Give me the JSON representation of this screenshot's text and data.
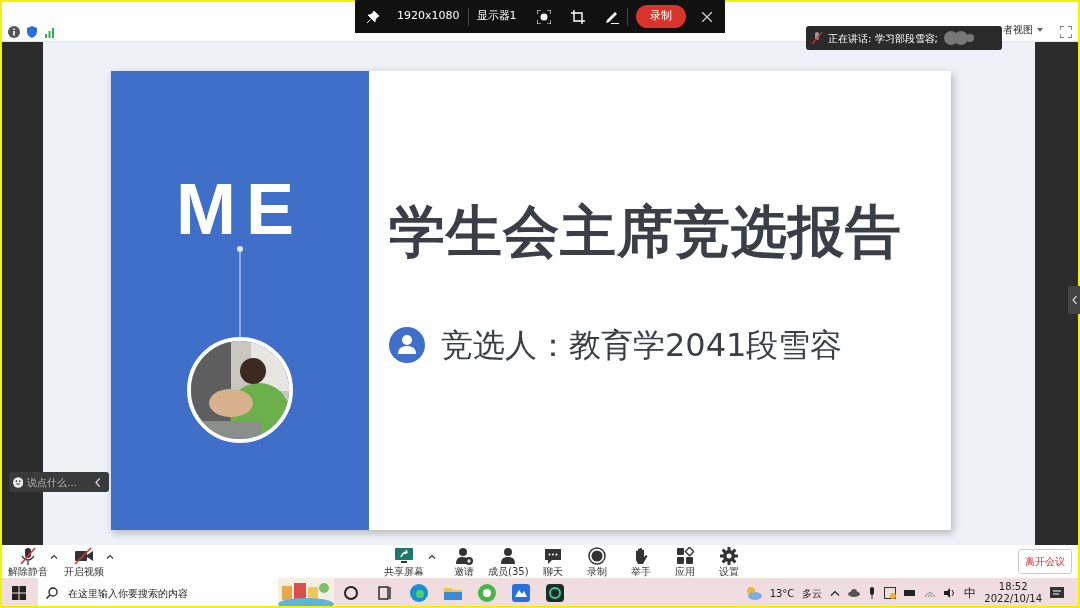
{
  "capture_bar": {
    "resolution": "1920x1080",
    "display": "显示器1",
    "record_button": "录制"
  },
  "view_menu": {
    "label": "者视图"
  },
  "speaker_notice": {
    "text": "正在讲话: 学习部段雪容;"
  },
  "slide": {
    "logo": "ME",
    "title": "学生会主席竞选报告",
    "candidate": "竞选人：教育学2041段雪容"
  },
  "chat_input": {
    "placeholder": "说点什么..."
  },
  "toolbar": {
    "left": [
      {
        "label": "解除静音",
        "kind": "mic",
        "off": true
      },
      {
        "label": "开启视频",
        "kind": "video",
        "off": true
      }
    ],
    "center": [
      {
        "label": "共享屏幕",
        "kind": "share"
      },
      {
        "label": "邀请",
        "kind": "invite"
      },
      {
        "label": "成员(35)",
        "kind": "members"
      },
      {
        "label": "聊天",
        "kind": "chat"
      },
      {
        "label": "录制",
        "kind": "record"
      },
      {
        "label": "举手",
        "kind": "hand"
      },
      {
        "label": "应用",
        "kind": "apps"
      },
      {
        "label": "设置",
        "kind": "settings"
      }
    ],
    "leave_button": "离开会议"
  },
  "taskbar": {
    "search_placeholder": "在这里输入你要搜索的内容",
    "weather": {
      "temp": "13°C",
      "condition": "多云"
    },
    "ime": "中",
    "time": "18:52",
    "date": "2022/10/14"
  }
}
